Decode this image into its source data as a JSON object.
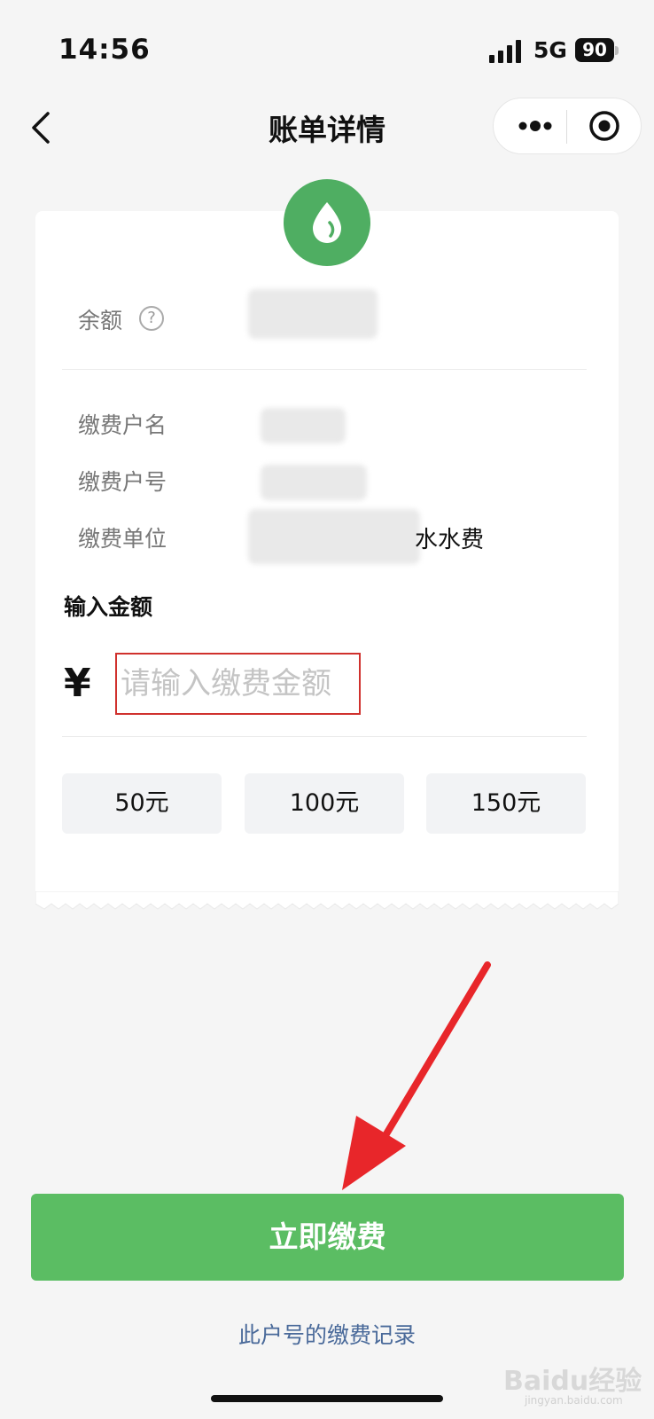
{
  "status_bar": {
    "time": "14:56",
    "network": "5G",
    "battery": "90"
  },
  "nav": {
    "title": "账单详情"
  },
  "balance": {
    "label": "余额"
  },
  "fields": {
    "name_label": "缴费户名",
    "number_label": "缴费户号",
    "unit_label": "缴费单位",
    "unit_suffix": "水水费"
  },
  "amount": {
    "title": "输入金额",
    "currency": "¥",
    "placeholder": "请输入缴费金额"
  },
  "quick_amounts": [
    "50元",
    "100元",
    "150元"
  ],
  "pay_button": "立即缴费",
  "record_link": "此户号的缴费记录",
  "watermark": {
    "brand": "Baidu经验",
    "url": "jingyan.baidu.com"
  },
  "colors": {
    "accent": "#5bbd63",
    "icon_bg": "#4fae62",
    "annotation": "#e8262a",
    "link": "#4a6a9a"
  }
}
